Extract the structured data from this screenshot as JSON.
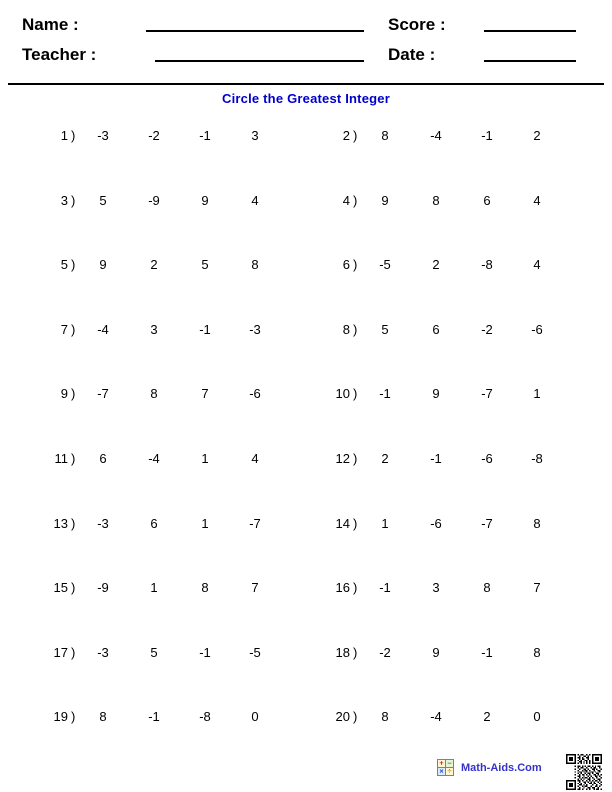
{
  "header": {
    "name_label": "Name :",
    "teacher_label": "Teacher :",
    "score_label": "Score :",
    "date_label": "Date :"
  },
  "title": "Circle the Greatest Integer",
  "problems": [
    {
      "number": "1",
      "paren": ")",
      "values": [
        "-3",
        "-2",
        "-1",
        "3"
      ]
    },
    {
      "number": "2",
      "paren": ")",
      "values": [
        "8",
        "-4",
        "-1",
        "2"
      ]
    },
    {
      "number": "3",
      "paren": ")",
      "values": [
        "5",
        "-9",
        "9",
        "4"
      ]
    },
    {
      "number": "4",
      "paren": ")",
      "values": [
        "9",
        "8",
        "6",
        "4"
      ]
    },
    {
      "number": "5",
      "paren": ")",
      "values": [
        "9",
        "2",
        "5",
        "8"
      ]
    },
    {
      "number": "6",
      "paren": ")",
      "values": [
        "-5",
        "2",
        "-8",
        "4"
      ]
    },
    {
      "number": "7",
      "paren": ")",
      "values": [
        "-4",
        "3",
        "-1",
        "-3"
      ]
    },
    {
      "number": "8",
      "paren": ")",
      "values": [
        "5",
        "6",
        "-2",
        "-6"
      ]
    },
    {
      "number": "9",
      "paren": ")",
      "values": [
        "-7",
        "8",
        "7",
        "-6"
      ]
    },
    {
      "number": "10",
      "paren": ")",
      "values": [
        "-1",
        "9",
        "-7",
        "1"
      ]
    },
    {
      "number": "11",
      "paren": ")",
      "values": [
        "6",
        "-4",
        "1",
        "4"
      ]
    },
    {
      "number": "12",
      "paren": ")",
      "values": [
        "2",
        "-1",
        "-6",
        "-8"
      ]
    },
    {
      "number": "13",
      "paren": ")",
      "values": [
        "-3",
        "6",
        "1",
        "-7"
      ]
    },
    {
      "number": "14",
      "paren": ")",
      "values": [
        "1",
        "-6",
        "-7",
        "8"
      ]
    },
    {
      "number": "15",
      "paren": ")",
      "values": [
        "-9",
        "1",
        "8",
        "7"
      ]
    },
    {
      "number": "16",
      "paren": ")",
      "values": [
        "-1",
        "3",
        "8",
        "7"
      ]
    },
    {
      "number": "17",
      "paren": ")",
      "values": [
        "-3",
        "5",
        "-1",
        "-5"
      ]
    },
    {
      "number": "18",
      "paren": ")",
      "values": [
        "-2",
        "9",
        "-1",
        "8"
      ]
    },
    {
      "number": "19",
      "paren": ")",
      "values": [
        "8",
        "-1",
        "-8",
        "0"
      ]
    },
    {
      "number": "20",
      "paren": ")",
      "values": [
        "8",
        "-4",
        "2",
        "0"
      ]
    }
  ],
  "footer": {
    "brand": "Math-Aids.Com",
    "icon_cells": [
      "+",
      "−",
      "×",
      "÷"
    ]
  },
  "colors": {
    "title": "#0000cc",
    "brand": "#3333cc",
    "text": "#000000"
  }
}
